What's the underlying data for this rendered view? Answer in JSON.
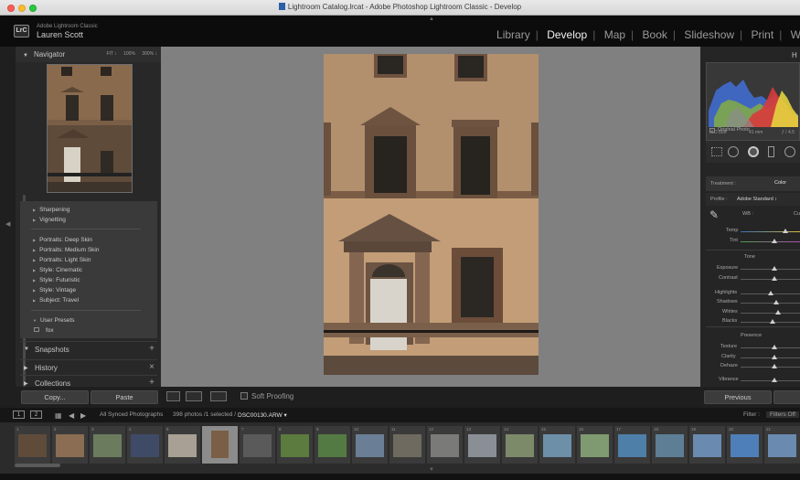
{
  "window": {
    "title": "Lightroom Catalog.lrcat - Adobe Photoshop Lightroom Classic - Develop"
  },
  "header": {
    "logo": "LrC",
    "app_name": "Adobe Lightroom Classic",
    "user_name": "Lauren Scott",
    "modules": [
      "Library",
      "Develop",
      "Map",
      "Book",
      "Slideshow",
      "Print",
      "W"
    ],
    "active_module": "Develop"
  },
  "left_panel": {
    "navigator_title": "Navigator",
    "zoom_options": [
      "FIT ↕",
      "100%",
      "300% ↕"
    ],
    "presets": [
      "Sharpening",
      "Vignetting",
      "Portraits: Deep Skin",
      "Portraits: Medium Skin",
      "Portraits: Light Skin",
      "Style: Cinematic",
      "Style: Futuristic",
      "Style: Vintage",
      "Subject: Travel"
    ],
    "user_presets_label": "User Presets",
    "user_preset_item": "fox",
    "snapshots_label": "Snapshots",
    "history_label": "History",
    "collections_label": "Collections",
    "copy_button": "Copy...",
    "paste_button": "Paste"
  },
  "toolbar": {
    "soft_proofing_label": "Soft Proofing"
  },
  "right_panel": {
    "histogram_title": "H",
    "iso": "ISO 800",
    "focal": "41 mm",
    "aperture": "ƒ / 4.5",
    "original_photo_label": "Original Photo",
    "treatment_label": "Treatment :",
    "treatment_value": "Color",
    "profile_label": "Profile :",
    "profile_value": "Adobe Standard ↕",
    "wb_label": "WB :",
    "wb_value": "Cu",
    "temp_label": "Temp",
    "tint_label": "Tint",
    "tone_label": "Tone",
    "exposure_label": "Exposure",
    "contrast_label": "Contrast",
    "highlights_label": "Highlights",
    "shadows_label": "Shadows",
    "whites_label": "Whites",
    "blacks_label": "Blacks",
    "presence_label": "Presence",
    "texture_label": "Texture",
    "clarity_label": "Clarity",
    "dehaze_label": "Dehaze",
    "vibrance_label": "Vibrance",
    "previous_button": "Previous"
  },
  "filmstrip_header": {
    "source": "All Synced Photographs",
    "count": "398 photos /1 selected /",
    "filename": "DSC00130.ARW ▾",
    "filter_label": "Filter :",
    "filter_value": "Filters Off"
  },
  "filmstrip": {
    "numbers": [
      "1",
      "2",
      "3",
      "4",
      "5",
      "6",
      "7",
      "8",
      "9",
      "10",
      "11",
      "12",
      "13",
      "14",
      "15",
      "16",
      "17",
      "18",
      "19",
      "20",
      "21"
    ],
    "selected_index": 5
  }
}
